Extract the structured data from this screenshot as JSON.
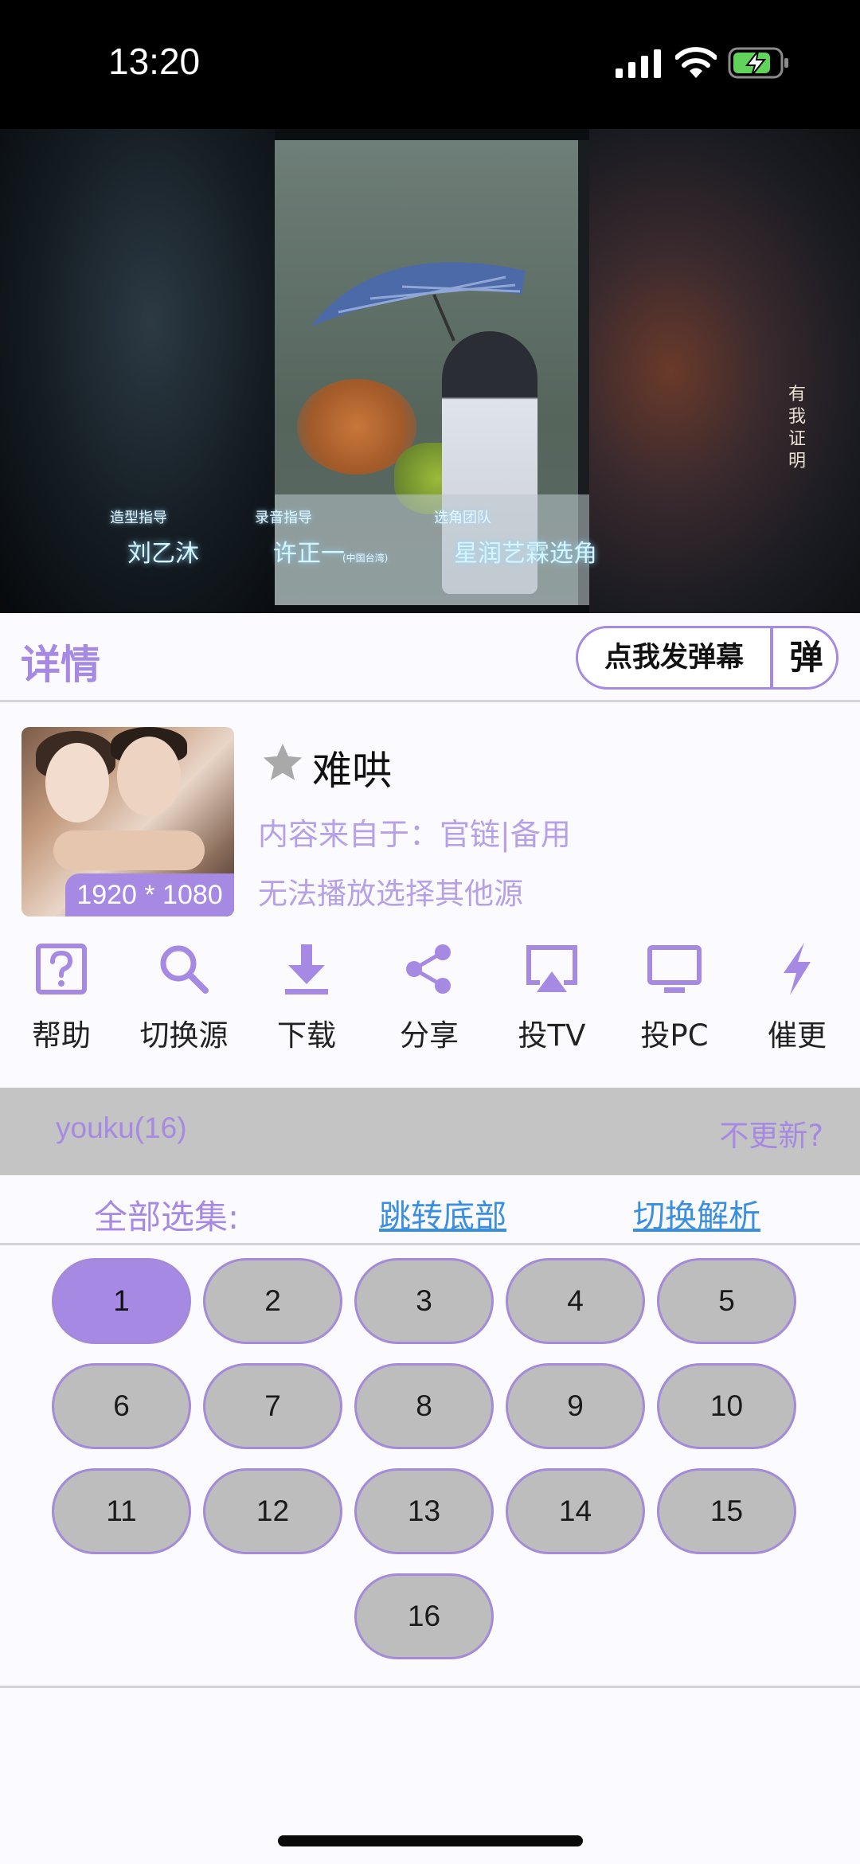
{
  "status_bar": {
    "time": "13:20",
    "icons": [
      "signal-icon",
      "wifi-icon",
      "battery-charging-icon"
    ]
  },
  "video": {
    "credits": [
      {
        "role": "造型指导",
        "name": "刘乙沐"
      },
      {
        "role": "录音指导",
        "name": "许正一"
      },
      {
        "role": "选角团队",
        "name": "星润艺霖选角"
      }
    ],
    "credit_note": "(中国台湾)",
    "watermark": "有我证明"
  },
  "detail": {
    "title": "详情",
    "danmu_button": "点我发弹幕",
    "danmu_short_button": "弹"
  },
  "show": {
    "resolution": "1920 * 1080",
    "title": "难哄",
    "source_label": "内容来自于：",
    "source_primary": "官链",
    "source_separator": "|",
    "source_backup": "备用",
    "hint": "无法播放选择其他源"
  },
  "actions": [
    {
      "label": "帮助",
      "icon": "help-icon"
    },
    {
      "label": "切换源",
      "icon": "search-icon"
    },
    {
      "label": "下载",
      "icon": "download-icon"
    },
    {
      "label": "分享",
      "icon": "share-icon"
    },
    {
      "label": "投TV",
      "icon": "airplay-icon"
    },
    {
      "label": "投PC",
      "icon": "monitor-icon"
    },
    {
      "label": "催更",
      "icon": "lightning-icon"
    }
  ],
  "source_bar": {
    "name": "youku(16)",
    "update_text": "不更新?"
  },
  "episodes": {
    "all_label": "全部选集:",
    "jump_bottom": "跳转底部",
    "switch_parse": "切换解析",
    "items": [
      "1",
      "2",
      "3",
      "4",
      "5",
      "6",
      "7",
      "8",
      "9",
      "10",
      "11",
      "12",
      "13",
      "14",
      "15",
      "16"
    ],
    "active": "1"
  },
  "colors": {
    "accent": "#a689e2",
    "link": "#3b8fe0",
    "source_bar_bg": "#c4c4c4",
    "episode_bg": "#bdbdbd"
  }
}
